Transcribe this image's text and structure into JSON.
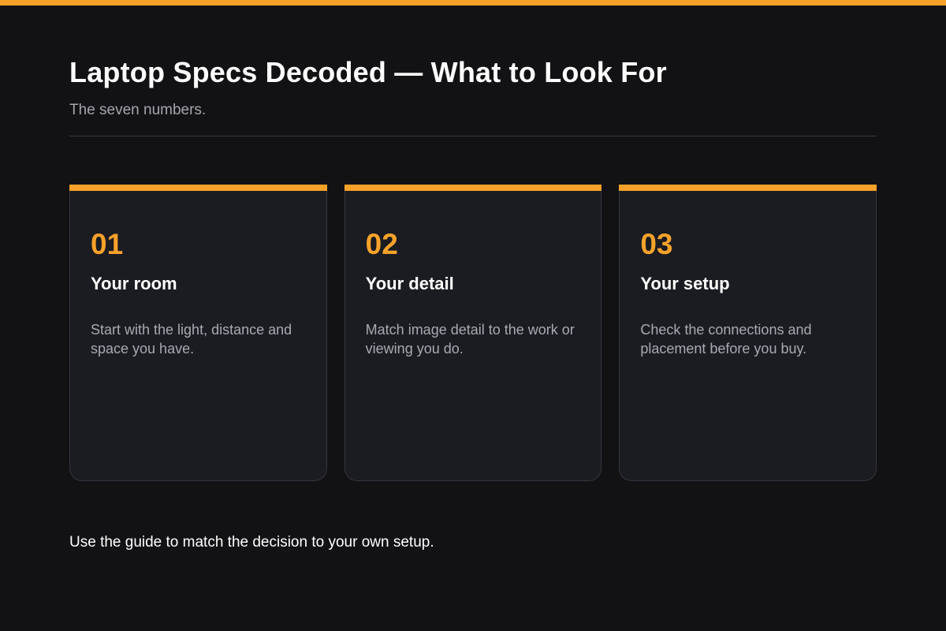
{
  "colors": {
    "accent": "#f6a22a",
    "background": "#121215",
    "card_background": "#1b1c21"
  },
  "header": {
    "title": "Laptop Specs Decoded — What to Look For",
    "subtitle": "The seven numbers."
  },
  "cards": [
    {
      "number": "01",
      "heading": "Your room",
      "body": "Start with the light, distance and space you have."
    },
    {
      "number": "02",
      "heading": "Your detail",
      "body": "Match image detail to the work or viewing you do."
    },
    {
      "number": "03",
      "heading": "Your setup",
      "body": "Check the connections and placement before you buy."
    }
  ],
  "footer": {
    "text": "Use the guide to match the decision to your own setup."
  }
}
